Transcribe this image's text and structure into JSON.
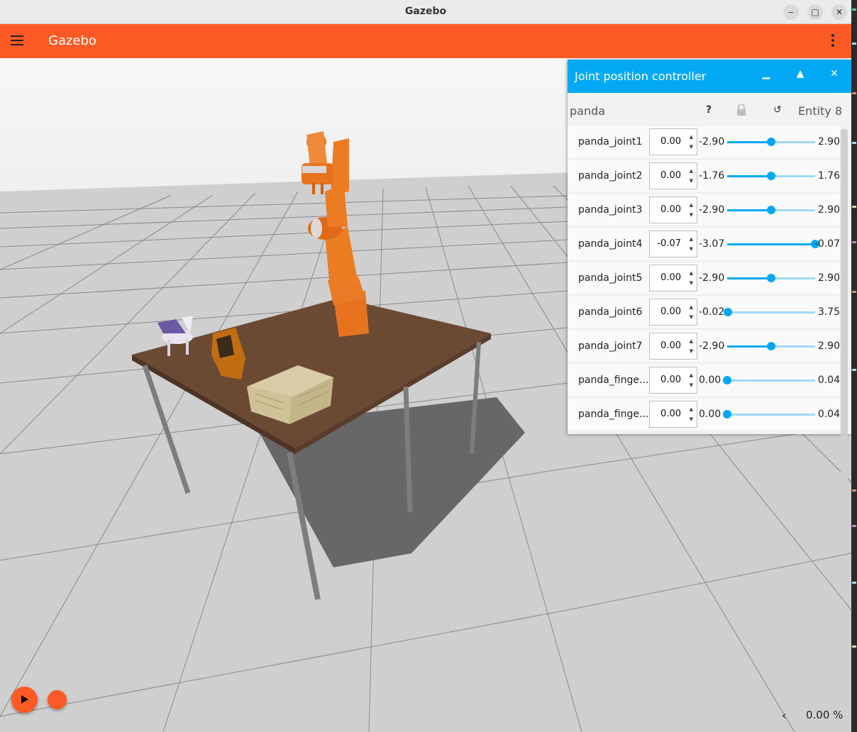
{
  "window": {
    "title": "Gazebo",
    "minimize": "‒",
    "maximize": "□",
    "close": "✕"
  },
  "app": {
    "title": "Gazebo"
  },
  "panel": {
    "title": "Joint position controller",
    "minimize_icon": "▁",
    "float_icon": "▲",
    "close_icon": "✕",
    "model": "panda",
    "help_icon": "?",
    "lock_icon": "🔒",
    "reset_icon": "↺",
    "entity": "Entity 8",
    "joints": [
      {
        "name": "panda_joint1",
        "value": "0.00",
        "min": "-2.90",
        "max": "2.90",
        "level": 0.5
      },
      {
        "name": "panda_joint2",
        "value": "0.00",
        "min": "-1.76",
        "max": "1.76",
        "level": 0.5
      },
      {
        "name": "panda_joint3",
        "value": "0.00",
        "min": "-2.90",
        "max": "2.90",
        "level": 0.5
      },
      {
        "name": "panda_joint4",
        "value": "-0.07",
        "min": "-3.07",
        "max": "-0.07",
        "level": 1.0
      },
      {
        "name": "panda_joint5",
        "value": "0.00",
        "min": "-2.90",
        "max": "2.90",
        "level": 0.5
      },
      {
        "name": "panda_joint6",
        "value": "0.00",
        "min": "-0.02",
        "max": "3.75",
        "level": 0.005
      },
      {
        "name": "panda_joint7",
        "value": "0.00",
        "min": "-2.90",
        "max": "2.90",
        "level": 0.5
      },
      {
        "name": "panda_finge...",
        "value": "0.00",
        "min": "0.00",
        "max": "0.04",
        "level": 0.0
      },
      {
        "name": "panda_finge...",
        "value": "0.00",
        "min": "0.00",
        "max": "0.04",
        "level": 0.0
      }
    ]
  },
  "bottom": {
    "collapse_icon": "‹",
    "rtf": "0.00 %"
  },
  "colors": {
    "accent": "#fe5a25",
    "panel_header": "#03a9f4"
  }
}
